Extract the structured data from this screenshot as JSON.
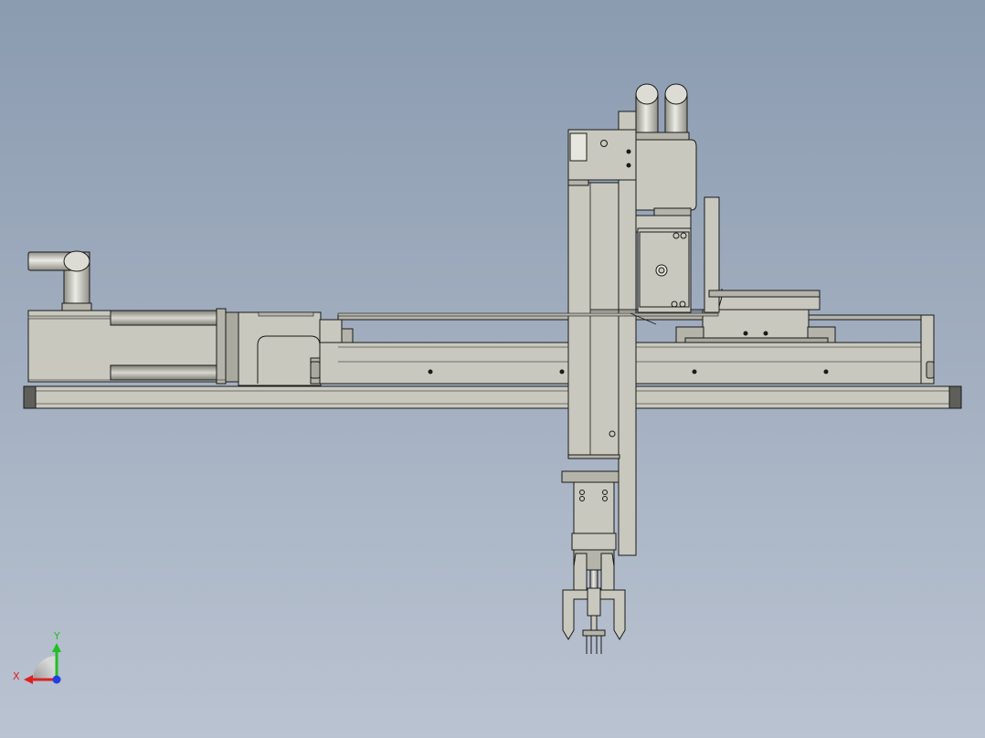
{
  "viewport": {
    "background_top": "#8b9bb0",
    "background_bottom": "#bac3d1"
  },
  "part_colors": {
    "body": "#c8c8be",
    "body_dark": "#a9a99f",
    "body_light": "#deded6",
    "edge": "#1a1a1a",
    "rail_end_cap": "#5f5f5a",
    "cylinder_light": "#e6e6df",
    "cylinder_dark": "#8e8e86"
  },
  "triad": {
    "x_label": "X",
    "y_label": "Y",
    "x_color": "#e02020",
    "y_color": "#20c020",
    "z_color": "#2040e0"
  }
}
